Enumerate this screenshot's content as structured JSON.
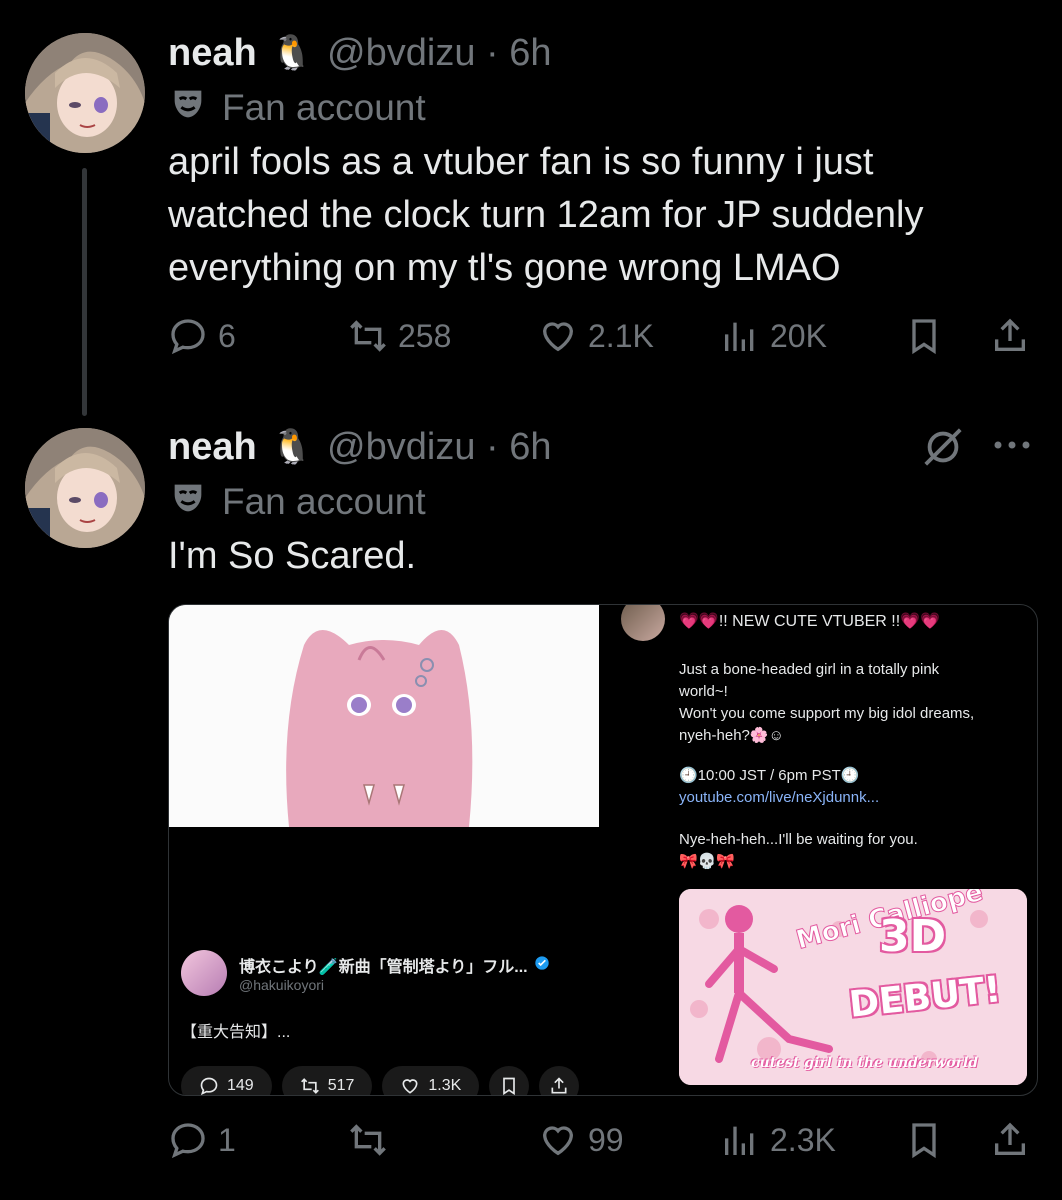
{
  "tweet1": {
    "name": "neah",
    "handle": "@bvdizu · 6h",
    "label": "Fan account",
    "text_lines": [
      "april fools as a vtuber fan is so funny i just",
      "watched the clock turn 12am for JP suddenly",
      "everything on my tl's gone wrong LMAO"
    ],
    "replies": "6",
    "reposts": "258",
    "likes": "2.1K",
    "views": "20K"
  },
  "tweet2": {
    "name": "neah",
    "handle": "@bvdizu · 6h",
    "label": "Fan account",
    "text": "I'm So Scared.",
    "replies": "1",
    "reposts": "",
    "likes": "99",
    "views": "2.3K"
  },
  "embedded_left": {
    "author": "博衣こより🧪新曲「管制塔より」フル...",
    "handle": "@hakuikoyori",
    "text": "【重大告知】...",
    "replies": "149",
    "reposts": "517",
    "likes": "1.3K"
  },
  "embedded_right": {
    "headline": "💗💗!! NEW CUTE VTUBER !!💗💗",
    "line1": "Just a bone-headed girl in a totally pink",
    "line2": "world~!",
    "line3": "Won't you come support my big idol dreams,",
    "line4": "nyeh-heh?🌸☺",
    "time": "🕘10:00 JST / 6pm PST🕘",
    "link": "youtube.com/live/neXjdunnk...",
    "line5": "Nye-heh-heh...I'll be waiting for you.",
    "line6": "🎀💀🎀",
    "banner_title_1": "3D",
    "banner_title_2": "DEBUT!",
    "banner_sub": "cutest girl in the underworld",
    "banner_logo": "Mori Calliope"
  },
  "colors": {
    "bg": "#000000",
    "text": "#e7e9ea",
    "muted": "#71767b",
    "pink": "#e35aa0",
    "link": "#8ab4f8"
  }
}
